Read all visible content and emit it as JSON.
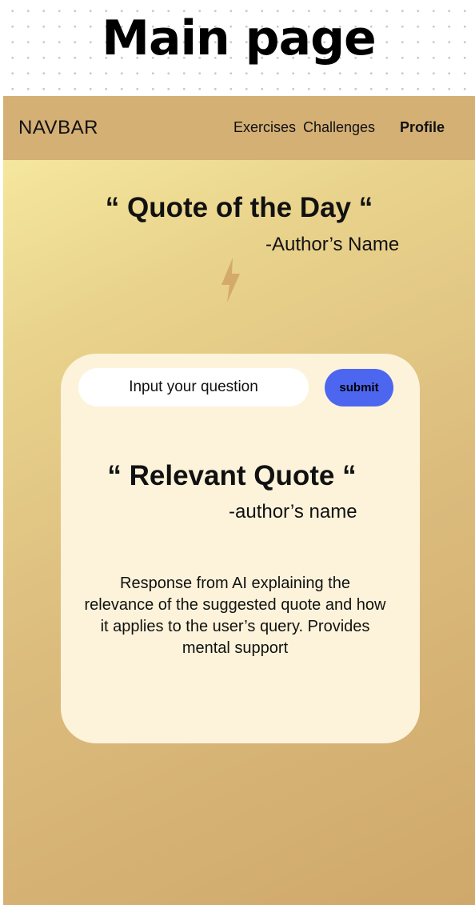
{
  "page": {
    "heading": "Main page"
  },
  "navbar": {
    "brand": "NAVBAR",
    "links": [
      "Exercises",
      "Challenges",
      "Profile"
    ],
    "active_link": "Profile",
    "background_color": "#d4b075"
  },
  "quote_of_day": {
    "text": "“ Quote of the Day  “",
    "author": "-Author’s Name",
    "icon": "lightning-bolt-icon"
  },
  "query_card": {
    "input_placeholder": "Input your question",
    "submit_label": "submit",
    "submit_color": "#4d66f0",
    "card_color": "#fcf3da"
  },
  "relevant_quote": {
    "text": "“ Relevant Quote “",
    "author": "-author’s name"
  },
  "ai_response": {
    "text": "Response from AI explaining the relevance of the suggested quote and how it applies to the user’s query. Provides mental support"
  },
  "theme": {
    "gradient_start": "#f9eea3",
    "gradient_end": "#cfa86b"
  }
}
